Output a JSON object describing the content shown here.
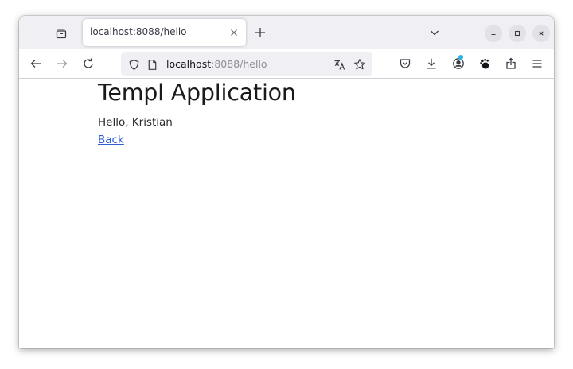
{
  "browser": {
    "tab": {
      "title": "localhost:8088/hello",
      "close_glyph": "×"
    },
    "new_tab_glyph": "+",
    "urlbar": {
      "host": "localhost",
      "rest": ":8088/hello"
    },
    "icons": {
      "tab_overview": "tab-overview-icon",
      "back": "back-arrow-icon",
      "forward": "forward-arrow-icon",
      "reload": "reload-icon",
      "tracking_shield": "shield-icon",
      "page_info": "page-icon",
      "translate": "translate-icon",
      "bookmark": "star-icon",
      "pocket": "pocket-icon",
      "downloads": "download-icon",
      "account": "account-icon",
      "extension": "gnome-foot-icon",
      "share": "share-icon",
      "menu": "hamburger-menu-icon",
      "list_all_tabs": "chevron-down-icon",
      "minimize": "minimize-icon",
      "maximize": "maximize-icon",
      "close_window": "close-icon"
    },
    "colors": {
      "tabstrip_bg": "#f0f0f4",
      "urlbar_bg": "#f0f0f4",
      "accent_dot": "#27b5e7",
      "link": "#2f5fcf"
    }
  },
  "page": {
    "title": "Templ Application",
    "greeting": "Hello, Kristian",
    "back_link": "Back"
  }
}
